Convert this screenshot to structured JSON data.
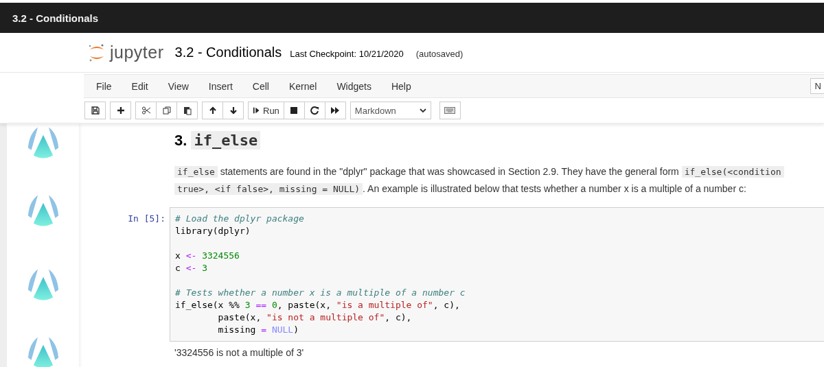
{
  "tab": {
    "title": "3.2 - Conditionals"
  },
  "header": {
    "logo_text": "jupyter",
    "notebook_name": "3.2 - Conditionals",
    "checkpoint": "Last Checkpoint: 10/21/2020",
    "autosave": "(autosaved)"
  },
  "menu": [
    "File",
    "Edit",
    "View",
    "Insert",
    "Cell",
    "Kernel",
    "Widgets",
    "Help"
  ],
  "kernel_indicator": "N",
  "toolbar": {
    "run_label": "Run",
    "cell_type": "Markdown"
  },
  "cells": [
    {
      "kind": "heading",
      "segments": [
        {
          "kind": "text",
          "text": "3. "
        },
        {
          "kind": "code",
          "text": "if_else"
        }
      ]
    },
    {
      "kind": "paragraph",
      "lines": [
        [
          {
            "kind": "code",
            "text": "if_else"
          },
          {
            "kind": "text",
            "text": " statements are found in the \"dplyr\" package that was showcased in Section 2.9. They have the general form "
          },
          {
            "kind": "code",
            "text": "if_else(<condition"
          }
        ],
        [
          {
            "kind": "code",
            "text": "true>, <if false>, missing = NULL)"
          },
          {
            "kind": "text",
            "text": ". An example is illustrated below that tests whether a number x is a multiple of a number c:"
          }
        ]
      ]
    },
    {
      "kind": "code",
      "prompt": "In [5]:",
      "blocks": [
        [
          [
            {
              "kind": "comment",
              "text": "# Load the dplyr package"
            }
          ],
          [
            {
              "kind": "plain",
              "text": "library(dplyr)"
            }
          ]
        ],
        [
          [
            {
              "kind": "plain",
              "text": "x "
            },
            {
              "kind": "op",
              "text": "<-"
            },
            {
              "kind": "num",
              "text": " 3324556"
            }
          ],
          [
            {
              "kind": "plain",
              "text": "c "
            },
            {
              "kind": "op",
              "text": "<-"
            },
            {
              "kind": "num",
              "text": " 3"
            }
          ]
        ],
        [
          [
            {
              "kind": "comment",
              "text": "# Tests whether a number x is a multiple of a number c"
            }
          ],
          [
            {
              "kind": "plain",
              "text": "if_else(x %% "
            },
            {
              "kind": "num",
              "text": "3"
            },
            {
              "kind": "op",
              "text": " == "
            },
            {
              "kind": "num",
              "text": "0"
            },
            {
              "kind": "plain",
              "text": ", paste(x, "
            },
            {
              "kind": "str",
              "text": "\"is a multiple of\""
            },
            {
              "kind": "plain",
              "text": ", c),"
            }
          ],
          [
            {
              "kind": "plain",
              "text": "        paste(x, "
            },
            {
              "kind": "str",
              "text": "\"is not a multiple of\""
            },
            {
              "kind": "plain",
              "text": ", c),"
            }
          ],
          [
            {
              "kind": "plain",
              "text": "        missing "
            },
            {
              "kind": "op",
              "text": "= "
            },
            {
              "kind": "null",
              "text": "NULL"
            },
            {
              "kind": "plain",
              "text": ")"
            }
          ]
        ]
      ],
      "output": "'3324556 is not a multiple of 3'"
    }
  ]
}
